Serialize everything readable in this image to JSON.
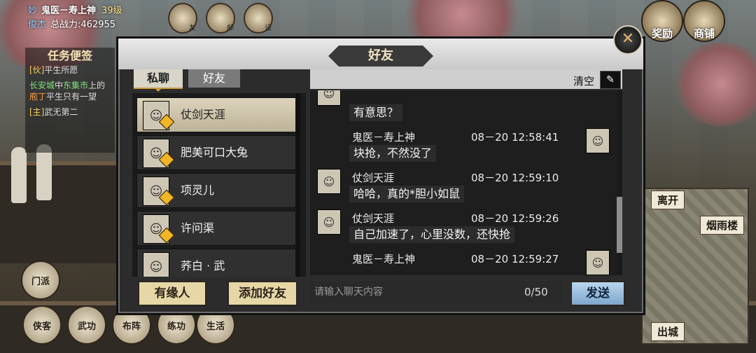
{
  "player": {
    "sect_line1": "妙",
    "sect_line2": "俊杰",
    "name": "鬼医－寿上神",
    "level": "39级",
    "power": "总战力:462955"
  },
  "top_icons": [
    {
      "label": "友",
      "icon": "friend-icon"
    },
    {
      "label": "邮",
      "icon": "mail-icon"
    },
    {
      "label": "设",
      "icon": "settings-icon"
    }
  ],
  "quest": {
    "title": "任务便签",
    "items": [
      {
        "tag": "[伙]",
        "text": "平生所愿"
      },
      {
        "loc": "长安城",
        "mid": "中",
        "npc": "东集市",
        "rest": "上的",
        "target": "庖丁",
        "tail": "平生只有一望"
      },
      {
        "tag": "[主]",
        "text": "武无第二"
      }
    ]
  },
  "left_buttons": [
    "门派",
    "侠客",
    "武功",
    "布阵",
    "练功",
    "生活"
  ],
  "right_buttons": [
    "奖励",
    "商铺"
  ],
  "map_labels": [
    "离开",
    "烟雨楼",
    "出城"
  ],
  "modal": {
    "title": "好友",
    "tabs": [
      "私聊",
      "好友"
    ],
    "clear_label": "清空",
    "contacts": [
      {
        "name": "仗剑天涯",
        "active": true
      },
      {
        "name": "肥美可口大兔",
        "active": false
      },
      {
        "name": "项灵儿",
        "active": false
      },
      {
        "name": "许问渠",
        "active": false
      },
      {
        "name": "荞白 · 武",
        "active": false
      }
    ],
    "messages": [
      {
        "sender": "",
        "time": "",
        "text": "有意思？",
        "side": "left"
      },
      {
        "sender": "鬼医－寿上神",
        "time": "08－20 12:58:41",
        "text": "块抢，不然没了",
        "side": "right"
      },
      {
        "sender": "仗剑天涯",
        "time": "08－20 12:59:10",
        "text": "哈哈，真的*胆小如鼠",
        "side": "left"
      },
      {
        "sender": "仗剑天涯",
        "time": "08－20 12:59:26",
        "text": "自己加速了，心里没数，还快抢",
        "side": "left"
      },
      {
        "sender": "鬼医－寿上神",
        "time": "08－20 12:59:27",
        "text": "",
        "side": "right"
      }
    ],
    "btn_destiny": "有缘人",
    "btn_add": "添加好友",
    "input_placeholder": "请输入聊天内容",
    "counter": "0/50",
    "btn_send": "发送"
  }
}
